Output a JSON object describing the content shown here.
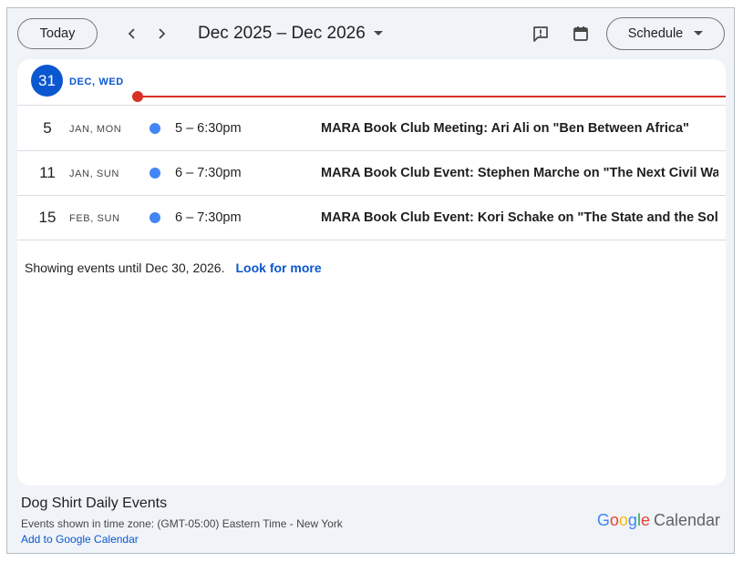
{
  "toolbar": {
    "today_label": "Today",
    "date_range": "Dec 2025 – Dec 2026",
    "view_label": "Schedule"
  },
  "today": {
    "day": "31",
    "label": "DEC, WED"
  },
  "events": [
    {
      "day": "5",
      "weekday": "JAN, MON",
      "time": "5 – 6:30pm",
      "title": "MARA Book Club Meeting: Ari Ali on \"Ben Between Africa\"",
      "color": "#4285f4"
    },
    {
      "day": "11",
      "weekday": "JAN, SUN",
      "time": "6 – 7:30pm",
      "title": "MARA Book Club Event: Stephen Marche on \"The Next Civil War\"",
      "color": "#4285f4"
    },
    {
      "day": "15",
      "weekday": "FEB, SUN",
      "time": "6 – 7:30pm",
      "title": "MARA Book Club Event: Kori Schake on \"The State and the Soldier\"",
      "color": "#4285f4"
    }
  ],
  "showing": {
    "text": "Showing events until Dec 30, 2026.",
    "link": "Look for more"
  },
  "footer": {
    "calendar_name": "Dog Shirt Daily Events",
    "timezone": "Events shown in time zone: (GMT-05:00) Eastern Time - New York",
    "add_link": "Add to Google Calendar",
    "logo_letters": [
      "G",
      "o",
      "o",
      "g",
      "l",
      "e"
    ],
    "logo_product": "Calendar"
  },
  "colors": {
    "accent": "#0b57d0",
    "now_line": "#d93025",
    "event_dot": "#4285f4"
  },
  "icons": {
    "prev": "chevron-left-icon",
    "next": "chevron-right-icon",
    "range_caret": "caret-down-icon",
    "feedback": "feedback-icon",
    "calendar": "calendar-icon",
    "view_caret": "caret-down-icon"
  }
}
